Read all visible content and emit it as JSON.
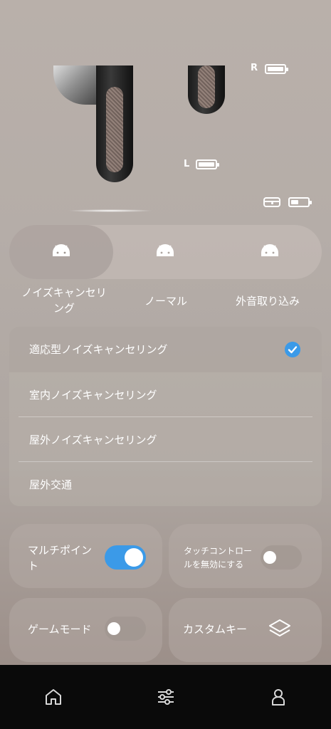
{
  "device": {
    "right_label": "R",
    "left_label": "L",
    "battery_right_level": 1.0,
    "battery_left_level": 1.0,
    "battery_case_level": 0.45
  },
  "modes": {
    "items": [
      {
        "label_line1": "ノイズキャンセリ",
        "label_line2": "ング",
        "icon": "android-robot-icon",
        "active": true
      },
      {
        "label_line1": "ノーマル",
        "label_line2": "",
        "icon": "android-robot-icon",
        "active": false
      },
      {
        "label_line1": "外音取り込み",
        "label_line2": "",
        "icon": "android-robot-icon",
        "active": false
      }
    ]
  },
  "anc_options": {
    "items": [
      {
        "label": "適応型ノイズキャンセリング",
        "selected": true
      },
      {
        "label": "室内ノイズキャンセリング",
        "selected": false
      },
      {
        "label": "屋外ノイズキャンセリング",
        "selected": false
      },
      {
        "label": "屋外交通",
        "selected": false
      }
    ]
  },
  "settings": {
    "multipoint_line1": "マルチポイン",
    "multipoint_line2": "ト",
    "multipoint_on": true,
    "touch_disable_line1": "タッチコントロー",
    "touch_disable_line2": "ルを無効にする",
    "touch_disable_on": false,
    "game_mode": "ゲームモード",
    "game_mode_on": false,
    "custom_key": "カスタムキー"
  },
  "nav": {
    "items": [
      "home-icon",
      "equalizer-sliders-icon",
      "profile-icon"
    ]
  },
  "colors": {
    "accent": "#3b9ae8",
    "navbar": "#0a0a0a"
  }
}
